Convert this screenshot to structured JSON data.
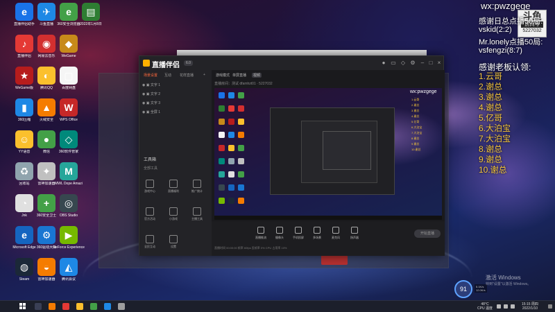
{
  "overlay": {
    "wx_title": "wx:pwzgege",
    "badge": {
      "logo": "斗鱼",
      "tag": "房间号",
      "room": "5227032"
    },
    "thanks_head": "感谢日总点播50局:",
    "thanks_lines": [
      "vskid(2:2)",
      "Mr.lonely点播50局:",
      "vsfengzi(8:7)"
    ],
    "boss_head": "感谢老板认领:",
    "boss_lines": [
      "1.云哥",
      "2.谢总",
      "3.谢总",
      "4.谢总",
      "5.亿哥",
      "6.大泊宝",
      "7.大泊宝",
      "8.谢总",
      "9.谢总",
      "10.谢总"
    ]
  },
  "desktop_icons": [
    {
      "label": "直播伴侣助手",
      "glyph": "e",
      "color": "#1a73e8"
    },
    {
      "label": "斗鱼直播",
      "glyph": "✈",
      "color": "#1e88e5"
    },
    {
      "label": "360安全浏览器",
      "glyph": "e",
      "color": "#43a047"
    },
    {
      "label": "2022年1月8日",
      "glyph": "▤",
      "color": "#2e7d32"
    },
    {
      "label": "直播伴侣",
      "glyph": "♪",
      "color": "#e53935"
    },
    {
      "label": "网易云音乐",
      "glyph": "◉",
      "color": "#d32f2f"
    },
    {
      "label": "WeGame",
      "glyph": "◆",
      "color": "#c78a1a"
    },
    {
      "label": "WeGame版",
      "glyph": "★",
      "color": "#b71c1c"
    },
    {
      "label": "腾讯QQ",
      "glyph": "◐",
      "color": "#fbc02d"
    },
    {
      "label": "百度网盘",
      "glyph": "▢",
      "color": "#f5f5f5"
    },
    {
      "label": "360压缩",
      "glyph": "▮",
      "color": "#1e88e5"
    },
    {
      "label": "火绒安全",
      "glyph": "▲",
      "color": "#f57c00"
    },
    {
      "label": "WPS Office",
      "glyph": "W",
      "color": "#c62828"
    },
    {
      "label": "YY语音",
      "glyph": "☺",
      "color": "#fbc02d"
    },
    {
      "label": "微信",
      "glyph": "●",
      "color": "#43a047"
    },
    {
      "label": "360软件管家",
      "glyph": "◇",
      "color": "#00897b"
    },
    {
      "label": "回收站",
      "glyph": "♻",
      "color": "#90a4ae"
    },
    {
      "label": "雷神加速器",
      "glyph": "✦",
      "color": "#c0c0c0"
    },
    {
      "label": "MWL Dope Amazi",
      "glyph": "M",
      "color": "#26a69a"
    },
    {
      "label": "Jnk",
      "glyph": "◔",
      "color": "#e0e0e0"
    },
    {
      "label": "360安全卫士",
      "glyph": "+",
      "color": "#43a047"
    },
    {
      "label": "OBS Studio",
      "glyph": "◎",
      "color": "#37474f"
    },
    {
      "label": "Microsoft Edge",
      "glyph": "e",
      "color": "#1565c0"
    },
    {
      "label": "360驱动大师",
      "glyph": "⚙",
      "color": "#1976d2"
    },
    {
      "label": "GeForce Experience",
      "glyph": "▶",
      "color": "#76b900"
    },
    {
      "label": "Steam",
      "glyph": "◍",
      "color": "#1b2838"
    },
    {
      "label": "雷神加速器",
      "glyph": "◒",
      "color": "#f57c00"
    },
    {
      "label": "腾讯会议",
      "glyph": "◭",
      "color": "#1e88e5"
    }
  ],
  "app": {
    "name": "直播伴侣",
    "version": "6.0",
    "side_tabs": [
      "场景设置",
      "互动",
      "花样直播"
    ],
    "scenes": [
      "文字 1",
      "文字 2",
      "文字 3",
      "全屏 1"
    ],
    "tools_title": "工具箱",
    "tools_sub": "全部工具",
    "tools": [
      "游戏中心",
      "直播福利",
      "推广统计",
      "官方活动",
      "小游戏",
      "主播工具",
      "全民互动",
      "设置"
    ],
    "main_tabs": [
      "游戏模式",
      "单屏直播",
      "视频"
    ],
    "room_line": "直播房间：测试  dfamhzt01 · 5227032",
    "toolbar": [
      "直播推流",
      "摄像头",
      "手机投屏",
      "多场景",
      "麦克风",
      "扬声器"
    ],
    "live_label": "开始直播",
    "status": "直播时间 00:00:00  帧率 60fps  丢帧率 0%  CPU 占用率 10%",
    "preview_wx": "wx:pwzgege"
  },
  "watermark": {
    "title": "激活 Windows",
    "sub": "转到\"设置\"以激活 Windows。"
  },
  "perf": {
    "percent": "91",
    "up": "5.1K/s",
    "down": "12.0K/s"
  },
  "tray": {
    "temp": "48°C",
    "cpu": "CPU 温度",
    "time": "15:15 周四",
    "date": "2022/1/10"
  }
}
